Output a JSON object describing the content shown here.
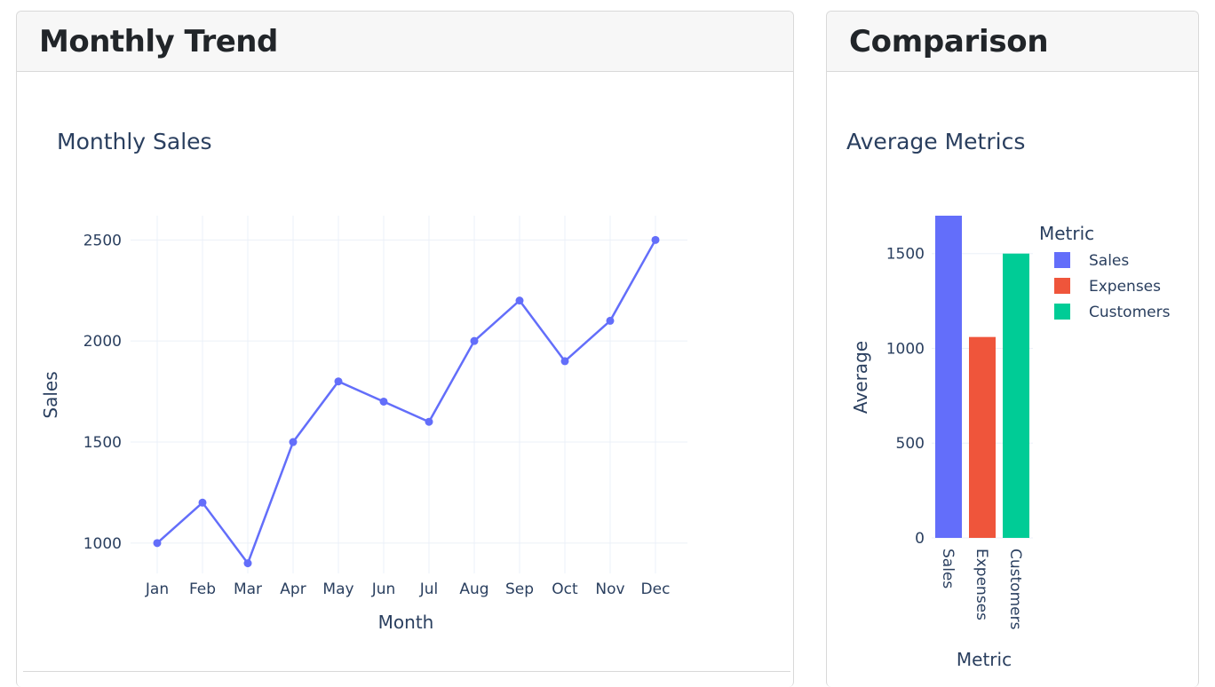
{
  "panels": {
    "left_title": "Monthly Trend",
    "right_title": "Comparison"
  },
  "chart_data": [
    {
      "type": "line",
      "title": "Monthly Sales",
      "xlabel": "Month",
      "ylabel": "Sales",
      "categories": [
        "Jan",
        "Feb",
        "Mar",
        "Apr",
        "May",
        "Jun",
        "Jul",
        "Aug",
        "Sep",
        "Oct",
        "Nov",
        "Dec"
      ],
      "values": [
        1000,
        1200,
        900,
        1500,
        1800,
        1700,
        1600,
        2000,
        2200,
        1900,
        2100,
        2500
      ],
      "yticks": [
        1000,
        1500,
        2000,
        2500
      ],
      "ylim": [
        850,
        2620
      ],
      "color": "#636efa",
      "grid": true
    },
    {
      "type": "bar",
      "title": "Average Metrics",
      "xlabel": "Metric",
      "ylabel": "Average",
      "categories": [
        "Sales",
        "Expenses",
        "Customers"
      ],
      "values": [
        1700,
        1060,
        1500
      ],
      "colors": [
        "#636efa",
        "#ef553b",
        "#00cc96"
      ],
      "yticks": [
        0,
        500,
        1000,
        1500
      ],
      "ylim": [
        0,
        1700
      ],
      "legend": {
        "title": "Metric",
        "placement": "right"
      },
      "grid": true
    }
  ]
}
